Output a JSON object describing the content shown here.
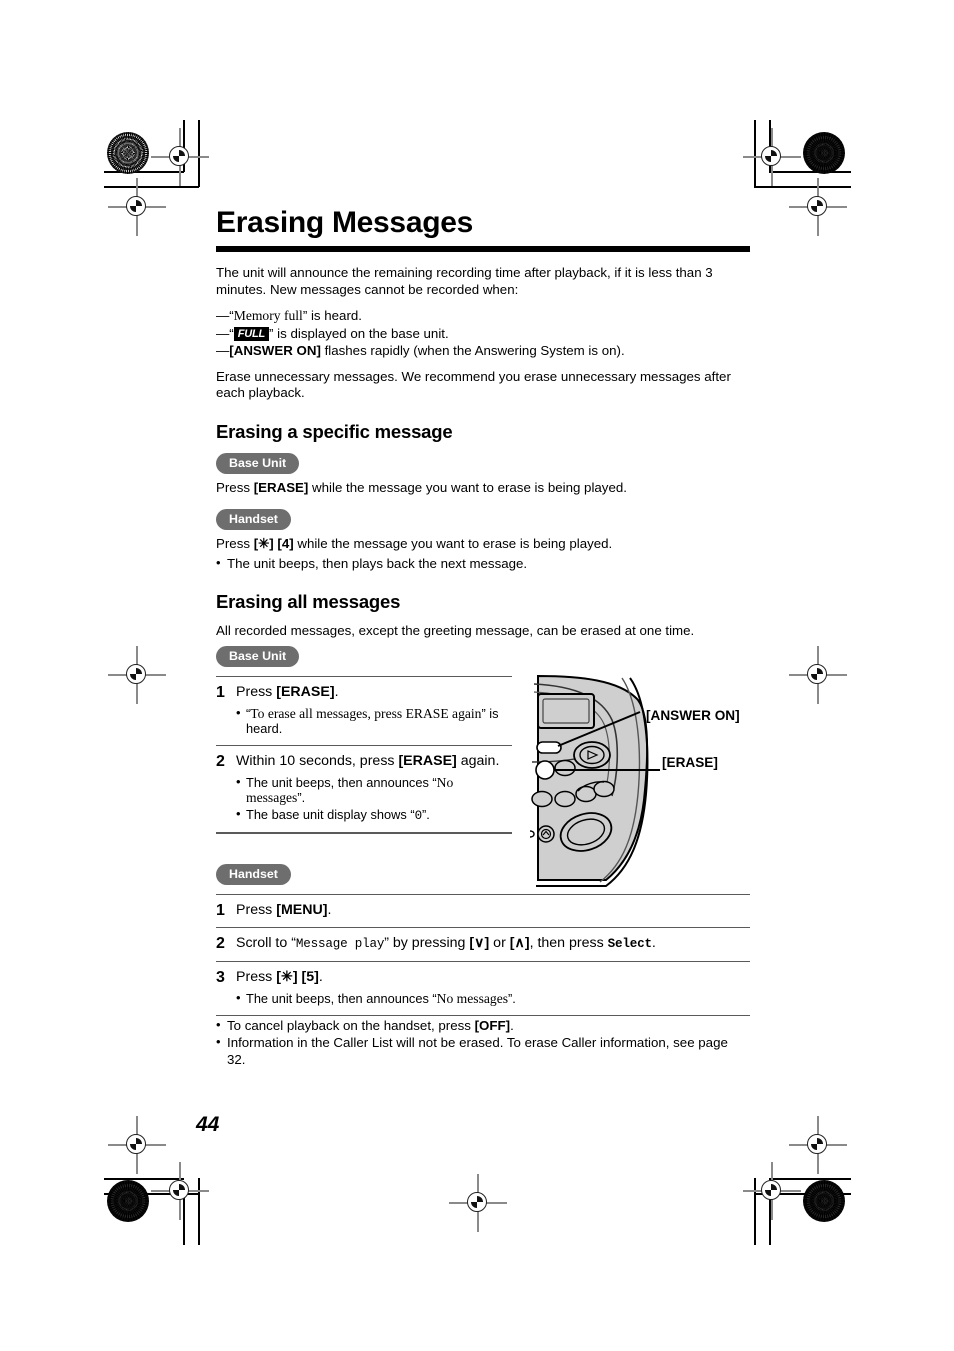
{
  "document": {
    "chapter_title": "Erasing Messages",
    "page_number": "44"
  },
  "intro": {
    "paragraph": "The unit will announce the remaining recording time after playback, if it is less than 3 minutes. New messages cannot be recorded when:",
    "conditions": [
      {
        "dash": "—",
        "quote_open": "“",
        "voice": "Memory full",
        "quote_close": "”",
        "rest": " is heard."
      },
      {
        "dash": "—",
        "quote_open": "“",
        "badge": "FULL",
        "quote_close": "”",
        "rest": " is displayed on the base unit."
      },
      {
        "dash": "—",
        "bold": "[ANSWER ON]",
        "rest": " flashes rapidly (when the Answering System is on)."
      }
    ],
    "closing": "Erase unnecessary messages. We recommend you erase unnecessary messages after each playback."
  },
  "section_specific": {
    "heading": "Erasing a specific message",
    "base_unit_pill": "Base Unit",
    "base_unit_text_pre": "Press ",
    "base_unit_key": "[ERASE]",
    "base_unit_text_post": " while the message you want to erase is being played.",
    "handset_pill": "Handset",
    "handset_text_pre": " Press ",
    "handset_key1": "[✳]",
    "handset_key2": "[4]",
    "handset_text_post": " while the message you want to erase is being played.",
    "note": "The unit beeps, then plays back the next message."
  },
  "section_all": {
    "heading": "Erasing all messages",
    "intro": "All recorded messages, except the greeting message, can be erased at one time.",
    "base_unit_pill": "Base Unit",
    "base_steps": [
      {
        "num": "1",
        "text_pre": "Press ",
        "key": "[ERASE]",
        "text_post": ".",
        "bullets": [
          {
            "pre": "“",
            "serif": "To erase all messages, press ERASE again",
            "post": "” is heard."
          }
        ]
      },
      {
        "num": "2",
        "text_pre": "Within 10 seconds, press ",
        "key": "[ERASE]",
        "text_post": " again.",
        "bullets": [
          {
            "pre": "The unit beeps, then announces “",
            "serif": "No messages",
            "post": "”."
          },
          {
            "pre": "The base unit display shows “",
            "mono": "0",
            "post": "”."
          }
        ]
      }
    ],
    "handset_pill": "Handset",
    "handset_steps": [
      {
        "num": "1",
        "text_pre": "Press ",
        "key": "[MENU]",
        "text_post": "."
      },
      {
        "num": "2",
        "text_pre": "Scroll to “",
        "mono_item": "Message play",
        "text_mid": "” by pressing ",
        "key_down": "[∨]",
        "text_or": " or ",
        "key_up": "[∧]",
        "text_then": ", then press ",
        "mono_select": "Select",
        "text_post": "."
      },
      {
        "num": "3",
        "text_pre": "Press ",
        "key1": "[✳]",
        "key2": "[5]",
        "text_post": ".",
        "bullets": [
          {
            "pre": "The unit beeps, then announces “",
            "serif": "No messages",
            "post": "”."
          }
        ]
      }
    ],
    "notes": [
      {
        "pre": "To cancel playback on the handset, press ",
        "key": "[OFF]",
        "post": "."
      },
      {
        "pre": "Information in the Caller List will not be erased. To erase Caller information, see page 32.",
        "key": "",
        "post": ""
      }
    ]
  },
  "illustration": {
    "name": "base-unit-diagram",
    "callouts": [
      {
        "label": "[ANSWER ON]"
      },
      {
        "label": "[ERASE]"
      }
    ],
    "colors": {
      "body_fill": "#cfcfcf",
      "outline": "#000000",
      "pill_gray": "#6e6e6e"
    }
  }
}
